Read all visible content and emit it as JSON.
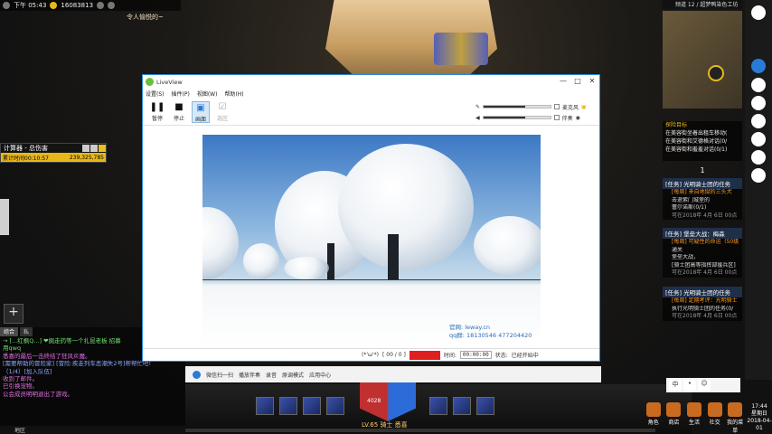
{
  "top": {
    "time": "下午 05:43",
    "gold": "16083813",
    "notice": "令人愉悦的~"
  },
  "calculator": {
    "title": "计算器 - 总伤害",
    "label": "累计时间00:10:57",
    "value": "239,325,785"
  },
  "chat": {
    "tabs": [
      "综合",
      "私"
    ],
    "lines": [
      "→ [...红枫Q...] ❤掘走药等一个扎昆老板 招募",
      "用qwq",
      "悉喜的最后一击终结了狂风炎魔。",
      "[需要帮助的冒险家] [冒险:疾走列车恶潮失2号]帮帮忙吧!",
      "（1/4）[加入队伍]",
      "收到了邮件。",
      "已引换宠物。",
      "公会成员明明退出了游戏。"
    ],
    "input_label": "地区"
  },
  "right_panel": {
    "channel": "频道 12 / 超梦鸭染色工坊",
    "quest_goal_header": "探险目标",
    "quest_goal_lines": [
      "在美容街坐着出租车移动(",
      "在美容街和艾德格对话(0/",
      "在美容街和羞羞对话(0/1)"
    ],
    "pager": "1",
    "quests": [
      {
        "header": "[任务] 光明骑士团的任务",
        "lines": [
          {
            "text": "[每周] 来自地狱的三头犬",
            "style": "orange"
          },
          {
            "text": "击退紫门城堡的",
            "style": "normal"
          },
          {
            "text": "蕾尔诺斯(0/1)",
            "style": "normal"
          },
          {
            "text": "可在2018年 4月 6日 00点",
            "style": "gray"
          }
        ]
      },
      {
        "header": "[任务] 堡垒大战：梅森",
        "lines": [
          {
            "text": "[每周] 可疑性的命运（50级",
            "style": "orange"
          },
          {
            "text": "通关",
            "style": "normal"
          },
          {
            "text": "堡垒大战，",
            "style": "normal"
          },
          {
            "text": "[骑士团高等指挥部援兵区]",
            "style": "normal"
          },
          {
            "text": "可在2018年 4月 6日 00点",
            "style": "gray"
          }
        ]
      },
      {
        "header": "[任务] 光明骑士团的任务",
        "lines": [
          {
            "text": "[每周] 定期考评：光明骑士",
            "style": "orange"
          },
          {
            "text": "执行光明骑士团的任务(0/",
            "style": "normal"
          },
          {
            "text": "可在2018年 4月 6日 00点",
            "style": "gray"
          }
        ]
      }
    ]
  },
  "hud": {
    "shield_value": "4028",
    "level": "LV.65 骑士 悉喜",
    "exp_percent": 0,
    "menu": [
      "角色",
      "商店",
      "生活",
      "社交",
      "我的菜单"
    ],
    "clock_time": "17:44",
    "clock_day": "星期日",
    "clock_date": "2018-04-01"
  },
  "taskbar": {
    "items": [
      "微信扫一扫",
      "播放伴奏",
      "录音",
      "原调模式",
      "应用中心"
    ]
  },
  "ime": [
    "中",
    "•",
    "☺"
  ],
  "liveview": {
    "title": "LiveView",
    "controls": [
      "—",
      "□",
      "✕"
    ],
    "menu": [
      "设置(S)",
      "插件(P)",
      "视图(W)",
      "帮助(H)"
    ],
    "tools": [
      {
        "glyph": "❚❚",
        "label": "暂停",
        "state": "normal"
      },
      {
        "glyph": "■",
        "label": "停止",
        "state": "normal"
      },
      {
        "glyph": "▣",
        "label": "画面",
        "state": "selected"
      },
      {
        "glyph": "☑",
        "label": "选区",
        "state": "disabled"
      }
    ],
    "slider_labels": [
      "麦克风",
      "伴奏"
    ],
    "slider_levels": [
      0.62,
      0.62
    ],
    "watermark": [
      "官网: leway.cn",
      "qq群: 18130546 477204420"
    ],
    "status": {
      "emote": "(*'ω'*)",
      "counter": "[ 00 / 0 ]",
      "time_label": "时间:",
      "time_value": "00:00:00",
      "state_label": "状态:",
      "state_value": "已经开始中"
    }
  }
}
